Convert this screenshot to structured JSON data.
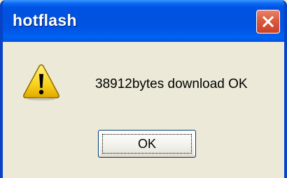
{
  "window": {
    "title": "hotflash"
  },
  "titlebar": {
    "close_icon": "close-x-icon",
    "close_color": "#dc5a3c"
  },
  "dialog": {
    "icon": "warning-icon",
    "message": "38912bytes download OK",
    "ok_label": "OK"
  },
  "colors": {
    "titlebar": "#0054e3",
    "background": "#ece9d8",
    "warning_fill": "#f8d21b"
  }
}
